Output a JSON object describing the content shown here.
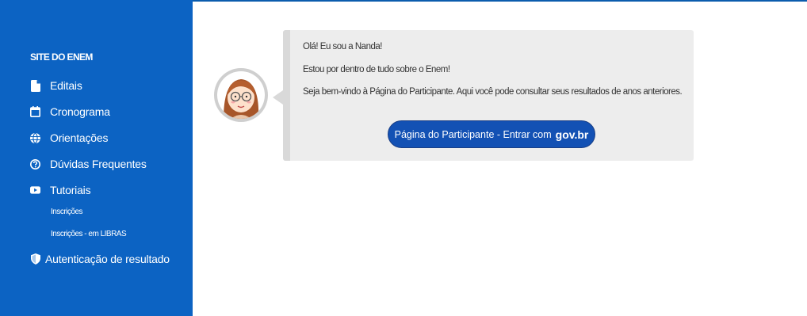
{
  "sidebar": {
    "title": "SITE DO ENEM",
    "items": [
      {
        "label": "Editais",
        "icon": "file-icon"
      },
      {
        "label": "Cronograma",
        "icon": "calendar-icon"
      },
      {
        "label": "Orientações",
        "icon": "globe-icon"
      },
      {
        "label": "Dúvidas Frequentes",
        "icon": "question-circle-icon"
      },
      {
        "label": "Tutoriais",
        "icon": "youtube-icon"
      }
    ],
    "subitems": [
      {
        "label": "Inscrições"
      },
      {
        "label": "Inscrições - em LIBRAS"
      }
    ],
    "auth": {
      "label": "Autenticação de resultado",
      "icon": "shield-icon"
    }
  },
  "chat": {
    "line1": "Olá! Eu sou a Nanda!",
    "line2": "Estou por dentro de tudo sobre o Enem!",
    "line3": "Seja bem-vindo à Página do Participante. Aqui você pode consultar seus resultados de anos anteriores.",
    "button_label": "Página do Participante - Entrar com",
    "button_brand": "gov.br"
  },
  "colors": {
    "sidebar": "#0c63c3",
    "button": "#1351b4",
    "bubble": "#ededed"
  }
}
